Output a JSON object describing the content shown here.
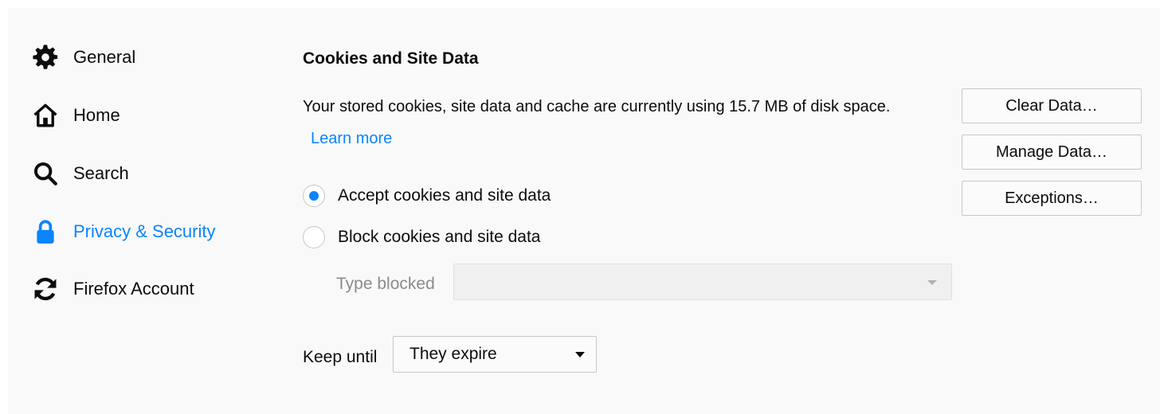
{
  "sidebar": {
    "items": [
      {
        "label": "General",
        "icon": "gear-icon"
      },
      {
        "label": "Home",
        "icon": "home-icon"
      },
      {
        "label": "Search",
        "icon": "search-icon"
      },
      {
        "label": "Privacy & Security",
        "icon": "lock-icon",
        "selected": true
      },
      {
        "label": "Firefox Account",
        "icon": "sync-icon"
      }
    ]
  },
  "cookies": {
    "title": "Cookies and Site Data",
    "description": "Your stored cookies, site data and cache are currently using 15.7 MB of disk space.",
    "learn_more": "Learn more",
    "buttons": {
      "clear_data": "Clear Data…",
      "manage_data": "Manage Data…",
      "exceptions": "Exceptions…"
    },
    "options": {
      "accept": "Accept cookies and site data",
      "block": "Block cookies and site data",
      "selected": "accept"
    },
    "type_blocked": {
      "label": "Type blocked",
      "value": ""
    },
    "keep_until": {
      "label": "Keep until",
      "value": "They expire"
    }
  },
  "colors": {
    "accent": "#0a84ff",
    "background": "#f9f9fa",
    "text": "#0c0c0d",
    "disabled_text": "#8a8a8f"
  }
}
